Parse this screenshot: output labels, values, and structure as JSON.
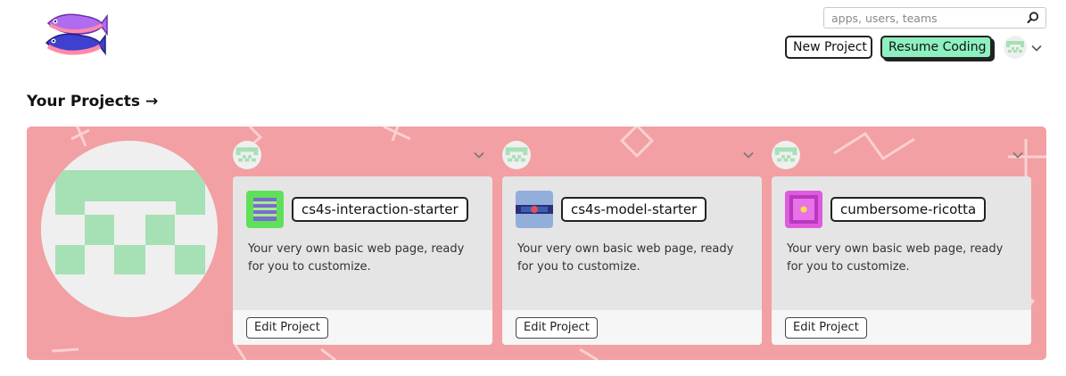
{
  "header": {
    "search": {
      "placeholder": "apps, users, teams",
      "value": ""
    },
    "new_project_label": "New Project",
    "resume_coding_label": "Resume Coding"
  },
  "section_title": "Your Projects →",
  "colors": {
    "banner": "#f2a0a3",
    "resume_button": "#8ef0c0",
    "avatar_green": "#a6e0b5",
    "card_bg": "#e5e5e5"
  },
  "projects": [
    {
      "name": "cs4s-interaction-starter",
      "description": "Your very own basic web page, ready for you to customize.",
      "edit_label": "Edit Project",
      "icon": "green-stack-icon"
    },
    {
      "name": "cs4s-model-starter",
      "description": "Your very own basic web page, ready for you to customize.",
      "edit_label": "Edit Project",
      "icon": "blue-band-icon"
    },
    {
      "name": "cumbersome-ricotta",
      "description": "Your very own basic web page, ready for you to customize.",
      "edit_label": "Edit Project",
      "icon": "magenta-frame-icon"
    }
  ]
}
